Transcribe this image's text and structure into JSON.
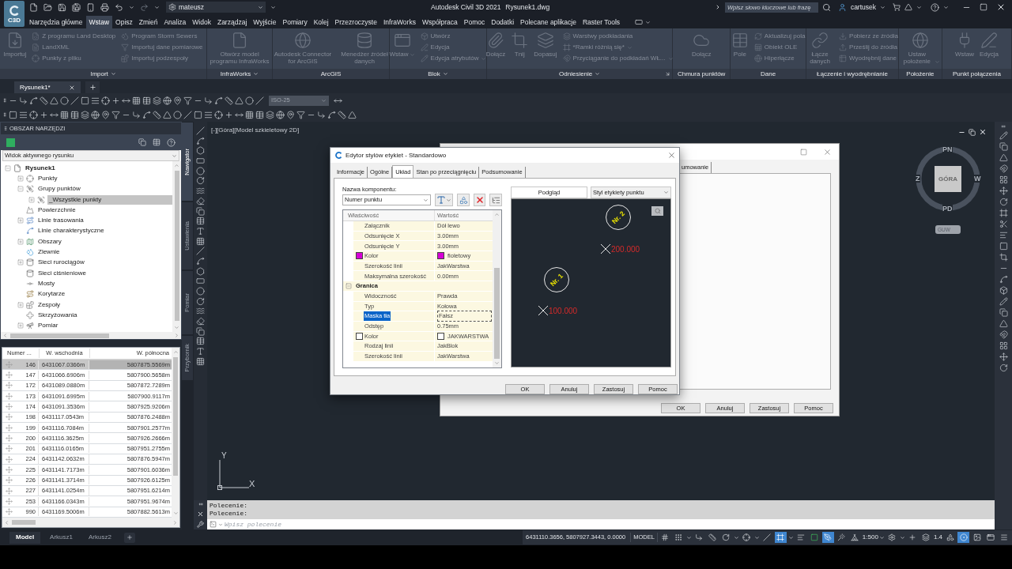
{
  "title_bar": {
    "app_badge": "C3D",
    "workspace": "mateusz",
    "app_name": "Autodesk Civil 3D 2021",
    "file_name": "Rysunek1.dwg",
    "search": {
      "placeholder": "Wpisz słowo kluczowe lub frazę"
    },
    "user": "cartusek"
  },
  "ribbon_tabs": [
    {
      "label": "Narzędzia główne",
      "selected": false
    },
    {
      "label": "Wstaw",
      "selected": true
    },
    {
      "label": "Opisz",
      "selected": false
    },
    {
      "label": "Zmień",
      "selected": false
    },
    {
      "label": "Analiza",
      "selected": false
    },
    {
      "label": "Widok",
      "selected": false
    },
    {
      "label": "Zarządzaj",
      "selected": false
    },
    {
      "label": "Wyjście",
      "selected": false
    },
    {
      "label": "Pomiary",
      "selected": false
    },
    {
      "label": "Kolej",
      "selected": false
    },
    {
      "label": "Przezroczyste",
      "selected": false
    },
    {
      "label": "InfraWorks",
      "selected": false
    },
    {
      "label": "Współpraca",
      "selected": false
    },
    {
      "label": "Pomoc",
      "selected": false
    },
    {
      "label": "Dodatki",
      "selected": false
    },
    {
      "label": "Polecane aplikacje",
      "selected": false
    },
    {
      "label": "Raster Tools",
      "selected": false
    }
  ],
  "ribbon": {
    "disabled": true,
    "groups": [
      {
        "label": "Import",
        "menu": true,
        "launcher": false,
        "items": [
          {
            "kind": "large",
            "label": "Importuj",
            "dropdown": false
          },
          {
            "kind": "small",
            "label": "Z programu Land Desktop",
            "dropdown": false
          },
          {
            "kind": "small",
            "label": "LandXML",
            "dropdown": false
          },
          {
            "kind": "small",
            "label": "Punkty z pliku",
            "dropdown": false
          },
          {
            "kind": "small",
            "label": "Program Storm Sewers",
            "dropdown": false
          },
          {
            "kind": "small",
            "label": "Importuj dane pomiarowe",
            "dropdown": false
          },
          {
            "kind": "small",
            "label": "Importuj podzespoły",
            "dropdown": false
          }
        ]
      },
      {
        "label": "InfraWorks",
        "menu": true,
        "launcher": false,
        "items": [
          {
            "kind": "large",
            "label": "Otwórz model programu InfraWorks",
            "dropdown": false
          }
        ]
      },
      {
        "label": "ArcGIS",
        "menu": false,
        "launcher": false,
        "items": [
          {
            "kind": "large",
            "label": "Autodesk Connector for ArcGIS",
            "dropdown": false
          },
          {
            "kind": "large",
            "label": "Menedżer źródeł danych",
            "dropdown": false
          }
        ]
      },
      {
        "label": "Blok",
        "menu": true,
        "launcher": false,
        "items": [
          {
            "kind": "large",
            "label": "Wstaw",
            "dropdown": true
          },
          {
            "kind": "small",
            "label": "Utwórz",
            "dropdown": false
          },
          {
            "kind": "small",
            "label": "Edycja",
            "dropdown": false
          },
          {
            "kind": "small",
            "label": "Edycja atrybutów",
            "dropdown": true
          }
        ]
      },
      {
        "label": "Odniesienie",
        "menu": true,
        "launcher": true,
        "items": [
          {
            "kind": "large",
            "label": "Dołącz",
            "dropdown": false
          },
          {
            "kind": "large",
            "label": "Tnij",
            "dropdown": false
          },
          {
            "kind": "large",
            "label": "Dopasuj",
            "dropdown": false
          },
          {
            "kind": "small",
            "label": "Warstwy podkładania",
            "dropdown": false
          },
          {
            "kind": "small",
            "label": "*Ramki różnią się*",
            "dropdown": true
          },
          {
            "kind": "small",
            "label": "Przyciąganie do podkładań WŁ...",
            "dropdown": true
          }
        ]
      },
      {
        "label": "Chmura punktów",
        "menu": false,
        "launcher": false,
        "items": [
          {
            "kind": "large",
            "label": "Dołącz",
            "dropdown": false
          }
        ]
      },
      {
        "label": "Dane",
        "menu": false,
        "launcher": false,
        "items": [
          {
            "kind": "large",
            "label": "Pole",
            "dropdown": false
          },
          {
            "kind": "small",
            "label": "Aktualizuj pola",
            "dropdown": false
          },
          {
            "kind": "small",
            "label": "Obiekt OLE",
            "dropdown": false
          },
          {
            "kind": "small",
            "label": "Hiperłącze",
            "dropdown": false
          }
        ]
      },
      {
        "label": "Łączenie i wyodrębnianie",
        "menu": false,
        "launcher": false,
        "items": [
          {
            "kind": "large",
            "label": "Łącze danych",
            "dropdown": false
          },
          {
            "kind": "small",
            "label": "Pobierz ze źródła",
            "dropdown": false
          },
          {
            "kind": "small",
            "label": "Prześlij do źródła",
            "dropdown": false
          },
          {
            "kind": "small",
            "label": "Wyodrębnij dane",
            "dropdown": false
          }
        ]
      },
      {
        "label": "Położenie",
        "menu": false,
        "launcher": false,
        "items": [
          {
            "kind": "large",
            "label": "Ustaw położenie",
            "dropdown": true
          }
        ]
      },
      {
        "label": "Punkt połączenia",
        "menu": false,
        "launcher": false,
        "items": [
          {
            "kind": "large",
            "label": "Wstaw",
            "dropdown": false
          },
          {
            "kind": "large",
            "label": "Edycja",
            "dropdown": false
          }
        ]
      }
    ]
  },
  "file_tabs": [
    {
      "label": "Rysunek1*",
      "selected": true
    }
  ],
  "toolbar": {
    "dim_style": {
      "value": "ISO-25",
      "disabled": true
    }
  },
  "toolspace": {
    "title": "OBSZAR NARZĘDZI",
    "view": "Widok aktywnego rysunku",
    "tree": [
      {
        "label": "Rysunek1",
        "expanded": true,
        "selected": false,
        "children": [
          {
            "label": "Punkty",
            "expanded": false,
            "selected": false
          },
          {
            "label": "Grupy punktów",
            "expanded": true,
            "selected": false,
            "children": [
              {
                "label": "_Wszystkie punkty",
                "expanded": false,
                "selected": true
              }
            ]
          },
          {
            "label": "Powierzchnie",
            "selected": false
          },
          {
            "label": "Linie trasowania",
            "expanded": false,
            "selected": false
          },
          {
            "label": "Linie charakterystyczne",
            "selected": false
          },
          {
            "label": "Obszary",
            "expanded": false,
            "selected": false
          },
          {
            "label": "Zlewnie",
            "selected": false
          },
          {
            "label": "Sieci rurociągów",
            "expanded": false,
            "selected": false
          },
          {
            "label": "Sieci ciśnieniowe",
            "selected": false
          },
          {
            "label": "Mosty",
            "selected": false
          },
          {
            "label": "Korytarze",
            "selected": false
          },
          {
            "label": "Zespoły",
            "expanded": false,
            "selected": false
          },
          {
            "label": "Skrzyżowania",
            "selected": false
          },
          {
            "label": "Pomiar",
            "expanded": false,
            "selected": false
          }
        ]
      }
    ]
  },
  "side_tabs": [
    {
      "label": "Nawigator",
      "selected": true
    },
    {
      "label": "Ustawienia",
      "selected": false
    },
    {
      "label": "Pomiar",
      "selected": false
    },
    {
      "label": "Przybornik",
      "selected": false
    }
  ],
  "points_table": {
    "columns": [
      "Numer ...",
      "W. wschodnia",
      "W. północna"
    ],
    "rows": [
      {
        "number": "146",
        "easting": "6431067.0366m",
        "northing": "5807875.5569m",
        "selected": true
      },
      {
        "number": "147",
        "easting": "6431066.6906m",
        "northing": "5807900.5658m",
        "selected": false
      },
      {
        "number": "172",
        "easting": "6431089.0880m",
        "northing": "5807872.7289m",
        "selected": false
      },
      {
        "number": "173",
        "easting": "6431091.6995m",
        "northing": "5807900.9117m",
        "selected": false
      },
      {
        "number": "174",
        "easting": "6431091.3536m",
        "northing": "5807925.9206m",
        "selected": false
      },
      {
        "number": "198",
        "easting": "6431117.0543m",
        "northing": "5807876.2488m",
        "selected": false
      },
      {
        "number": "199",
        "easting": "6431116.7084m",
        "northing": "5807901.2577m",
        "selected": false
      },
      {
        "number": "200",
        "easting": "6431116.3625m",
        "northing": "5807926.2666m",
        "selected": false
      },
      {
        "number": "201",
        "easting": "6431116.0165m",
        "northing": "5807951.2755m",
        "selected": false
      },
      {
        "number": "224",
        "easting": "6431142.0632m",
        "northing": "5807876.5947m",
        "selected": false
      },
      {
        "number": "225",
        "easting": "6431141.7173m",
        "northing": "5807901.6036m",
        "selected": false
      },
      {
        "number": "226",
        "easting": "6431141.3714m",
        "northing": "5807926.6125m",
        "selected": false
      },
      {
        "number": "227",
        "easting": "6431141.0254m",
        "northing": "5807951.6214m",
        "selected": false
      },
      {
        "number": "253",
        "easting": "6431166.0343m",
        "northing": "5807951.9674m",
        "selected": false
      },
      {
        "number": "990",
        "easting": "6431169.5006m",
        "northing": "5807882.5613m",
        "selected": false
      }
    ]
  },
  "viewport": {
    "label": "[-][Góra][Model szkieletowy 2D]",
    "viewcube": {
      "top": "PN",
      "bottom": "PD",
      "left": "Z",
      "right": "W",
      "face": "GÓRA",
      "ucs_menu": "GUW"
    },
    "ucs": {
      "x": "X",
      "y": "Y"
    }
  },
  "back_dialog": {
    "tab_fragment": "umowanie",
    "buttons": [
      "OK",
      "Anuluj",
      "Zastosuj",
      "Pomoc"
    ]
  },
  "dialog": {
    "title": "Edytor stylów etykiet - Standardowo",
    "tabs": [
      {
        "label": "Informacje",
        "selected": false
      },
      {
        "label": "Ogólne",
        "selected": false
      },
      {
        "label": "Układ",
        "selected": true
      },
      {
        "label": "Stan po przeciągnięciu",
        "selected": false
      },
      {
        "label": "Podsumowanie",
        "selected": false
      }
    ],
    "component_label": "Nazwa komponentu:",
    "component": "Numer punktu",
    "grid": {
      "columns": [
        "Właściwość",
        "Wartość"
      ],
      "rows": [
        {
          "kind": "property",
          "name": "Załącznik",
          "value": "Dół lewo",
          "selected": false
        },
        {
          "kind": "property",
          "name": "Odsunięcie X",
          "value": "3.00mm",
          "selected": false
        },
        {
          "kind": "property",
          "name": "Odsunięcie Y",
          "value": "3.00mm",
          "selected": false
        },
        {
          "kind": "property",
          "name": "Kolor",
          "value": "fioletowy",
          "color": "#d600d6",
          "selected": false
        },
        {
          "kind": "property",
          "name": "Szerokość linii",
          "value": "JakWarstwa",
          "selected": false
        },
        {
          "kind": "property",
          "name": "Maksymalna szerokość",
          "value": "0.00mm",
          "selected": false
        },
        {
          "kind": "category",
          "name": "Granica",
          "expanded": true,
          "selected": false
        },
        {
          "kind": "property",
          "name": "Widoczność",
          "value": "Prawda",
          "selected": false
        },
        {
          "kind": "property",
          "name": "Typ",
          "value": "Kołowa",
          "selected": false
        },
        {
          "kind": "property",
          "name": "Maska tła",
          "value": "Fałsz",
          "selected": true
        },
        {
          "kind": "property",
          "name": "Odstęp",
          "value": "0.75mm",
          "selected": false
        },
        {
          "kind": "property",
          "name": "Kolor",
          "value": "JAKWARSTWA",
          "color": "#ffffff",
          "selected": false
        },
        {
          "kind": "property",
          "name": "Rodzaj linii",
          "value": "JakBlok",
          "selected": false
        },
        {
          "kind": "property",
          "name": "Szerokość linii",
          "value": "JakWarstwa",
          "selected": false
        }
      ]
    },
    "preview": {
      "tab": "Podgląd",
      "style": "Styl etykiety punktu",
      "labels": [
        {
          "circle": "Nr. 2",
          "value": "200.000"
        },
        {
          "circle": "Nr. 1",
          "value": "100.000"
        }
      ]
    },
    "buttons": [
      "OK",
      "Anuluj",
      "Zastosuj",
      "Pomoc"
    ]
  },
  "command_line": {
    "history": [
      "Polecenie:",
      "Polecenie:"
    ],
    "placeholder": "Wpisz polecenie"
  },
  "layout_tabs": [
    {
      "label": "Model",
      "selected": true
    },
    {
      "label": "Arkusz1",
      "selected": false
    },
    {
      "label": "Arkusz2",
      "selected": false
    }
  ],
  "status_bar": {
    "coordinates": "6431110.3656, 5807927.3443, 0.0000",
    "space": "MODEL",
    "scale": "1:500",
    "precision": "1.4",
    "toggles": [
      {
        "on": false
      },
      {
        "on": false
      },
      {
        "on": false
      },
      {
        "on": false
      },
      {
        "on": false
      },
      {
        "on": false
      },
      {
        "on": false
      },
      {
        "on": true
      },
      {
        "on": false
      },
      {
        "on": false
      },
      {
        "on": true
      },
      {
        "on": false
      },
      {
        "on": false
      },
      {
        "on": false
      },
      {
        "on": false
      },
      {
        "on": false
      },
      {
        "on": false
      },
      {
        "on": true
      },
      {
        "on": false
      },
      {
        "on": false
      },
      {
        "on": false
      }
    ]
  }
}
